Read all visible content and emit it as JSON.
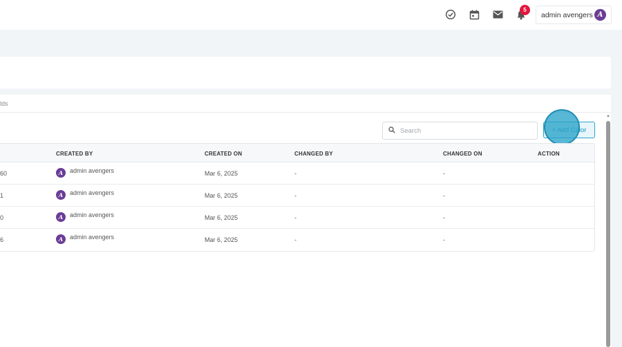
{
  "header": {
    "icons": [
      "check-circle-icon",
      "calendar-icon",
      "mail-icon",
      "bell-icon"
    ],
    "notification_count": "5",
    "user_name": "admin avengers"
  },
  "breadcrumb_fragment": "lds",
  "toolbar": {
    "search_placeholder": "Search",
    "add_button_label": "+ Add Color"
  },
  "table": {
    "columns": [
      "CREATED BY",
      "CREATED ON",
      "CHANGED BY",
      "CHANGED ON",
      "ACTION"
    ],
    "rows": [
      {
        "first_cell": "60",
        "created_by": "admin avengers",
        "created_on": "Mar 6, 2025",
        "changed_by": "-",
        "changed_on": "-"
      },
      {
        "first_cell": "1",
        "created_by": "admin avengers",
        "created_on": "Mar 6, 2025",
        "changed_by": "-",
        "changed_on": "-"
      },
      {
        "first_cell": "0",
        "created_by": "admin avengers",
        "created_on": "Mar 6, 2025",
        "changed_by": "-",
        "changed_on": "-"
      },
      {
        "first_cell": "6",
        "created_by": "admin avengers",
        "created_on": "Mar 6, 2025",
        "changed_by": "-",
        "changed_on": "-"
      }
    ]
  },
  "colors": {
    "accent": "#29a3c9",
    "badge": "#e3173e",
    "avatar": "#6a3d96",
    "background": "#f2f5f8"
  }
}
